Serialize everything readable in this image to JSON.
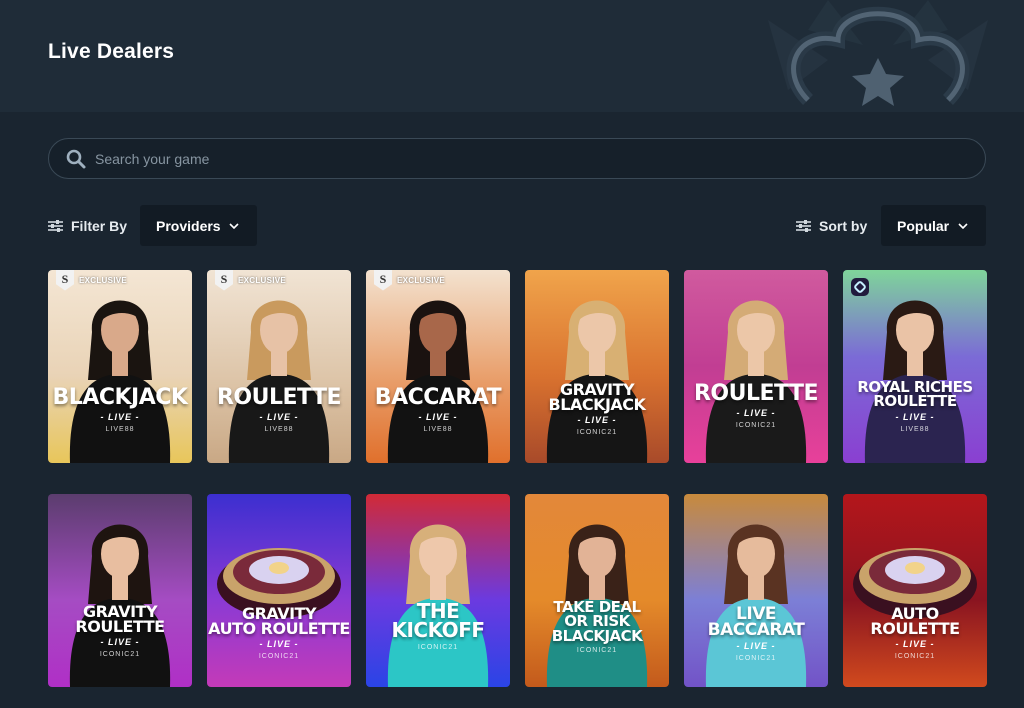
{
  "page": {
    "title": "Live Dealers"
  },
  "search": {
    "placeholder": "Search your game"
  },
  "filter": {
    "label": "Filter By",
    "selected": "Providers"
  },
  "sort": {
    "label": "Sort by",
    "selected": "Popular"
  },
  "games": [
    {
      "title": "BLACKJACK",
      "live": "- LIVE -",
      "provider": "LIVE88",
      "badge": "EXCLUSIVE",
      "badge_letter": "S"
    },
    {
      "title": "ROULETTE",
      "live": "- LIVE -",
      "provider": "LIVE88",
      "badge": "EXCLUSIVE",
      "badge_letter": "S"
    },
    {
      "title": "BACCARAT",
      "live": "- LIVE -",
      "provider": "LIVE88",
      "badge": "EXCLUSIVE",
      "badge_letter": "S"
    },
    {
      "title": "GRAVITY BLACKJACK",
      "live": "- LIVE -",
      "provider": "ICONIC21"
    },
    {
      "title": "ROULETTE",
      "live": "- LIVE -",
      "provider": "ICONIC21"
    },
    {
      "title": "ROYAL RICHES ROULETTE",
      "live": "- LIVE -",
      "provider": "LIVE88"
    },
    {
      "title": "GRAVITY ROULETTE",
      "live": "- LIVE -",
      "provider": "ICONIC21"
    },
    {
      "title": "GRAVITY AUTO ROULETTE",
      "live": "- LIVE -",
      "provider": "ICONIC21"
    },
    {
      "title": "THE KICKOFF",
      "live": "",
      "provider": "ICONIC21"
    },
    {
      "title": "TAKE DEAL OR RISK BLACKJACK",
      "live": "",
      "provider": "ICONIC21"
    },
    {
      "title": "LIVE BACCARAT",
      "live": "- LIVE -",
      "provider": "ICONIC21"
    },
    {
      "title": "AUTO ROULETTE",
      "live": "- LIVE -",
      "provider": "ICONIC21"
    }
  ],
  "colors": {
    "background": "#1a2530",
    "header": "#1f2c38",
    "dropdown": "#121b24",
    "search_border": "#3a4956"
  },
  "icons": {
    "search": "search-icon",
    "filter": "sliders-icon",
    "sort": "sliders-icon",
    "dropdown": "chevron-down-icon"
  }
}
